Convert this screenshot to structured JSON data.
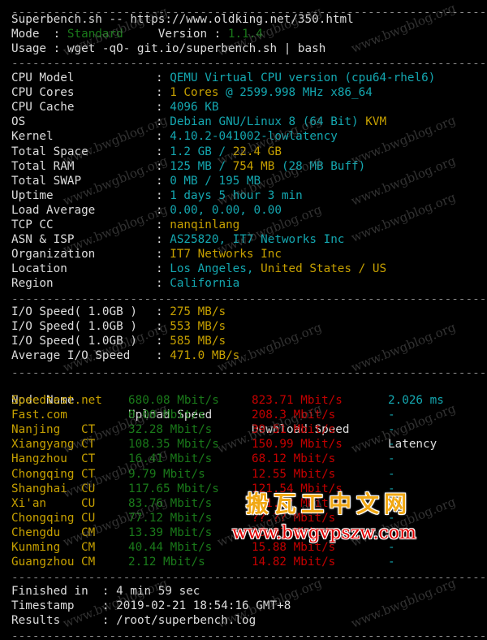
{
  "header": {
    "title_line": "Superbench.sh -- https://www.oldking.net/350.html",
    "mode_label": "Mode  : ",
    "mode_value": "Standard",
    "version_label": "Version : ",
    "version_value": "1.1.4",
    "usage_line": "Usage : wget -qO- git.io/superbench.sh | bash"
  },
  "system": [
    {
      "label": "CPU Model",
      "parts": [
        {
          "text": "QEMU Virtual CPU version (cpu64-rhel6)",
          "color": "c"
        }
      ]
    },
    {
      "label": "CPU Cores",
      "parts": [
        {
          "text": "1 Cores ",
          "color": "y"
        },
        {
          "text": "@ 2599.998 MHz x86_64",
          "color": "c"
        }
      ]
    },
    {
      "label": "CPU Cache",
      "parts": [
        {
          "text": "4096 KB",
          "color": "c"
        }
      ]
    },
    {
      "label": "OS",
      "parts": [
        {
          "text": "Debian GNU/Linux 8 (64 Bit) ",
          "color": "c"
        },
        {
          "text": "KVM",
          "color": "y"
        }
      ]
    },
    {
      "label": "Kernel",
      "parts": [
        {
          "text": "4.10.2-041002-lowlatency",
          "color": "c"
        }
      ]
    },
    {
      "label": "Total Space",
      "parts": [
        {
          "text": "1.2 GB / ",
          "color": "c"
        },
        {
          "text": "22.4 GB",
          "color": "y"
        }
      ]
    },
    {
      "label": "Total RAM",
      "parts": [
        {
          "text": "125 MB / ",
          "color": "c"
        },
        {
          "text": "754 MB",
          "color": "y"
        },
        {
          "text": " (28 MB Buff)",
          "color": "c"
        }
      ]
    },
    {
      "label": "Total SWAP",
      "parts": [
        {
          "text": "0 MB / 195 MB",
          "color": "c"
        }
      ]
    },
    {
      "label": "Uptime",
      "parts": [
        {
          "text": "1 days 5 hour 3 min",
          "color": "c"
        }
      ]
    },
    {
      "label": "Load Average",
      "parts": [
        {
          "text": "0.00, 0.00, 0.00",
          "color": "c"
        }
      ]
    },
    {
      "label": "TCP CC",
      "parts": [
        {
          "text": "nanqinlang",
          "color": "y"
        }
      ]
    },
    {
      "label": "ASN & ISP",
      "parts": [
        {
          "text": "AS25820, IT7 Networks Inc",
          "color": "c"
        }
      ]
    },
    {
      "label": "Organization",
      "parts": [
        {
          "text": "IT7 Networks Inc",
          "color": "y"
        }
      ]
    },
    {
      "label": "Location",
      "parts": [
        {
          "text": "Los Angeles, ",
          "color": "c"
        },
        {
          "text": "United States / US",
          "color": "y"
        }
      ]
    },
    {
      "label": "Region",
      "parts": [
        {
          "text": "California",
          "color": "c"
        }
      ]
    }
  ],
  "io": [
    {
      "label": "I/O Speed( 1.0GB )",
      "value": "275 MB/s"
    },
    {
      "label": "I/O Speed( 1.0GB )",
      "value": "553 MB/s"
    },
    {
      "label": "I/O Speed( 1.0GB )",
      "value": "585 MB/s"
    },
    {
      "label": "Average I/O Speed",
      "value": "471.0 MB/s"
    }
  ],
  "speedtest": {
    "headers": [
      "Node Name",
      "Upload Speed",
      "Download Speed",
      "Latency"
    ],
    "rows": [
      {
        "node": "Speedtest.net",
        "isp": "",
        "upload": "680.08 Mbit/s",
        "download": "823.71 Mbit/s",
        "latency": "2.026 ms"
      },
      {
        "node": "Fast.com",
        "isp": "",
        "upload": "0.00 Mbit/s",
        "download": "208.3 Mbit/s",
        "latency": "-"
      },
      {
        "node": "Nanjing",
        "isp": "CT",
        "upload": "32.28 Mbit/s",
        "download": "39.51 Mbit/s",
        "latency": "-"
      },
      {
        "node": "Xiangyang",
        "isp": "CT",
        "upload": "108.35 Mbit/s",
        "download": "150.99 Mbit/s",
        "latency": "-"
      },
      {
        "node": "Hangzhou",
        "isp": "CT",
        "upload": "16.41 Mbit/s",
        "download": "68.12 Mbit/s",
        "latency": "-"
      },
      {
        "node": "Chongqing",
        "isp": "CT",
        "upload": "9.79 Mbit/s",
        "download": "12.55 Mbit/s",
        "latency": "-"
      },
      {
        "node": "Shanghai",
        "isp": "CU",
        "upload": "117.65 Mbit/s",
        "download": "121.54 Mbit/s",
        "latency": "-"
      },
      {
        "node": "Xi'an",
        "isp": "CU",
        "upload": "83.76 Mbit/s",
        "download": "101.6? Mbit/s",
        "latency": "-"
      },
      {
        "node": "Chongqing",
        "isp": "CU",
        "upload": "77.12 Mbit/s",
        "download": "??.?? Mbit/s",
        "latency": "-"
      },
      {
        "node": "Chengdu",
        "isp": "CM",
        "upload": "13.39 Mbit/s",
        "download": "16.9? Mbit/s",
        "latency": "-"
      },
      {
        "node": "Kunming",
        "isp": "CM",
        "upload": "40.44 Mbit/s",
        "download": "15.88 Mbit/s",
        "latency": "-"
      },
      {
        "node": "Guangzhou",
        "isp": "CM",
        "upload": "2.12 Mbit/s",
        "download": "14.82 Mbit/s",
        "latency": "-"
      }
    ]
  },
  "footer": [
    {
      "label": "Finished in  : ",
      "value": "4 min 59 sec"
    },
    {
      "label": "Timestamp    : ",
      "value": "2019-02-21 18:54:16 GMT+8"
    },
    {
      "label": "Results      : ",
      "value": "/root/superbench.log"
    }
  ],
  "watermarks": {
    "text": "www.bwgblog.org",
    "overlay_cn": "搬瓦工中文网",
    "overlay_url": "www.bwgvpszw.com"
  },
  "colors": {
    "background": "#000000",
    "label": "#dcdcdc",
    "green": "#1a7a1a",
    "yellow": "#c6a000",
    "cyan": "#14a7b0",
    "red": "#c40000"
  }
}
